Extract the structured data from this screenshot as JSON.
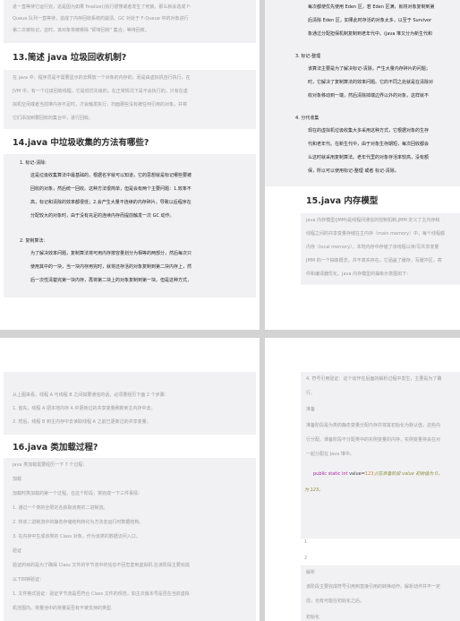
{
  "p1": {
    "top_lines": [
      "进一直等待它运行完，这是因为如果 finalize()执行很慢或者发生了死锁，那么就会造成 F-",
      "Queue 队列一直等待，造成了内存回收系统的崩溃。GC 对处于 F-Queue 中的对象进行",
      "第二次被标记，这时，该对象将被移除 \"即将回收\" 集合，等待回收。"
    ],
    "h13": "13.简述 java 垃圾回收机制?",
    "s13": [
      "在 java 中，程序员是不需要显示的去释放一个对象的内存的，而是由虚拟机自行执行。在",
      "JVM 中，有一个垃圾回收线程，它是低优先级的，在正常情况下是不会执行的，只有在虚",
      "拟机空闲或者当前堆内存不足时，才会触发执行，扫面那些没有被任何引用的对象，并将",
      "它们添加到要回收的集合中，进行回收。"
    ],
    "h14": "14.java 中垃圾收集的方法有哪些?",
    "item1_title": "1.  标记-清除:",
    "item1": [
      "这是垃圾收集算法中最基础的，根据名字就可以知道，它的思想就是标记哪些要被",
      "回收的对象，然后统一回收。这种方法很简单，但是会有两个主要问题：1.效率不",
      "高，标记和清除的效率都很低；2.会产生大量不连续的内存碎片，导致以后程序在",
      "分配较大的对象时，由于没有充足的连续内存而提前触发一次 GC 动作。"
    ],
    "item2_title": "2.  复制算法:",
    "item2": [
      "为了解决效率问题，复制算法将可用内存按容量划分为相等的两部分，然后每次只",
      "使用其中的一块，当一块内存用完时，就将还存活的对象复制到第二块内存上，然",
      "后一次性清楚完第一块内存，再将第二块上的对象复制到第一块。但是这种方式，"
    ]
  },
  "p2": {
    "top_lines": [
      "每次都使优先使用 Eden 区，若 Eden 区满，就将对象复制到第",
      "后清除 Eden 区，如果此时存活的对象太多，以至于 Survivor",
      "象通过分配担保机制复制到老年代中。(java 堆又分为新生代和"
    ],
    "item3_title": "3.  标记-整理",
    "item3": [
      "该算法主要是为了解决标记-清除，产生大量内存碎片的问题；",
      "时，它解决了复制算法的效率问题。它的不同之处就是在清除对",
      "收对象移动到一端，然后清除掉端边界以外的对象，这样就不"
    ],
    "item4_title": "4.  分代收集",
    "item4": [
      "现在的虚拟机垃圾收集大多采用这种方式，它根据对象的生存",
      "代和老年代。在新生代中，由于对象生存期短，每次回收都会",
      "么这时就采用复制算法。老年代里的对象存活率较高，没有额",
      "保，所以可以使用标记-整理 或者 标记-清除。"
    ],
    "h15": "15.java 内存模型",
    "s15": [
      "java 内存模型(JMM)是线程间通信的控制机制.JMM 定义了主内存和",
      "线程之间的共享变量存储在主内存（main memory）中，每个线程都",
      "内存（local memory），本地内存中存储了该线程以读/写共享变量",
      "JMM 的一个抽象概念，并不真实存在。它涵盖了缓存，写缓冲区，寄",
      "件和编译器优化。Java 内存模型的抽象示意图如下："
    ]
  },
  "p3": {
    "top_lines": [
      "从上图来看，线程 A 与线程 B 之间如要通信的话，必须要经历下面 2 个步骤：",
      "1. 首先，线程 A 把本地内存 A 中更新过的共享变量刷新到主内存中去。",
      "2. 然后，线程 B 到主内存中去读取线程 A 之前已更新过的共享变量。"
    ],
    "h16": "16.java 类加载过程?",
    "lines": [
      "java 类加载需要经历一下 7 个过程：",
      "加载",
      "加载时类加载的第一个过程，在这个阶段，将完成一下三件事情：",
      "1. 通过一个类的全限定名获取该类的二进制流。",
      "2. 将该二进制流中的静态存储结构转化为方法去运行时数据结构。",
      "3. 在内存中生成该类的 Class 对象，作为该类的数据访问入口。",
      "验证",
      "验证的目的是为了确保 Class 文件的字节流中的信息不回危害到虚拟机.在该阶段主要完成",
      "以下四钟验证：",
      "1. 文件格式验证：验证字节流是否符合 Class 文件的规范，如主次版本号是否在当前虚拟",
      "机范围内，常量池中的常量是否有不被支持的类型."
    ]
  },
  "p4": {
    "top_lines": [
      "4. 符号引用验证：这个动作在后面的解析过程中发生，主要是为了确",
      "行。"
    ],
    "prep_title": "准备",
    "prep": [
      "准备阶段是为类的静态变量分配内存并将其初始化为默认值，这些内",
      "行分配。准备阶段不分配类中的实例变量的内存，实例变量将会在对",
      "一起分配在 Java 堆中。"
    ],
    "code_kw": "public static int",
    "code_var": " value=",
    "code_num": "123",
    "code_comment": ";//在准备阶段 value 初始值为 0，",
    "code_cont": "为 123。",
    "bullets": [
      "1",
      "2"
    ],
    "parse_title": "解析",
    "parse": [
      "该阶段主要完成符号引用到直接引用的转换动作。解析动作并不一定",
      "前，也有可能在初始化之后。"
    ],
    "init_title": "初始化"
  }
}
